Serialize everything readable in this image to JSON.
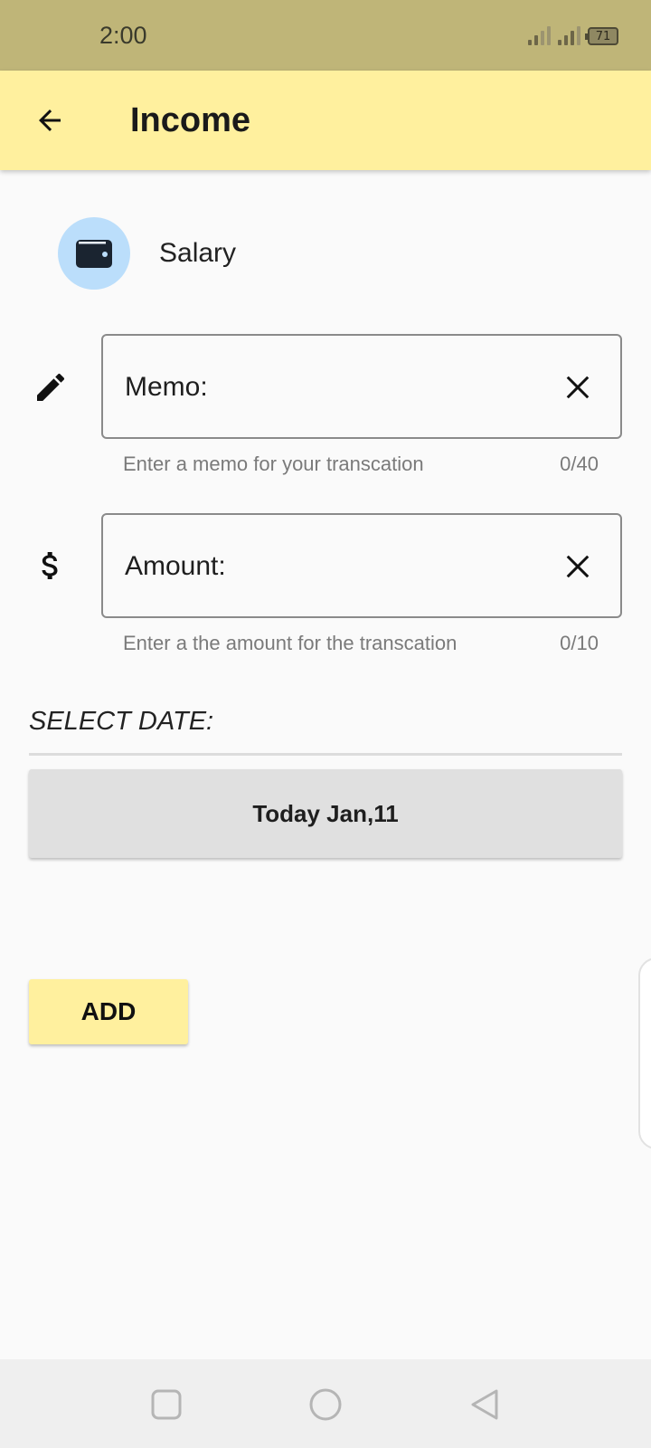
{
  "status_bar": {
    "time": "2:00",
    "battery_level": "71"
  },
  "app_bar": {
    "title": "Income",
    "back_icon": "arrow-left-icon"
  },
  "category": {
    "icon": "wallet-icon",
    "label": "Salary",
    "avatar_color": "#bbdefb"
  },
  "memo_field": {
    "icon": "pencil-icon",
    "label": "Memo:",
    "helper": "Enter a memo for your transcation",
    "counter": "0/40"
  },
  "amount_field": {
    "icon": "dollar-icon",
    "label": "Amount:",
    "helper": "Enter a the amount for the transcation",
    "counter": "0/10"
  },
  "date_section": {
    "label": "SELECT DATE:",
    "button_label": "Today Jan,11"
  },
  "add_button": {
    "label": "ADD"
  },
  "nav_bar": {
    "recents_icon": "square-icon",
    "home_icon": "circle-icon",
    "back_icon": "triangle-back-icon"
  },
  "colors": {
    "status_bar": "#bfb578",
    "app_bar": "#fff09e",
    "background": "#fafafa",
    "date_button": "#e0e0e0",
    "add_button": "#fff09e"
  }
}
